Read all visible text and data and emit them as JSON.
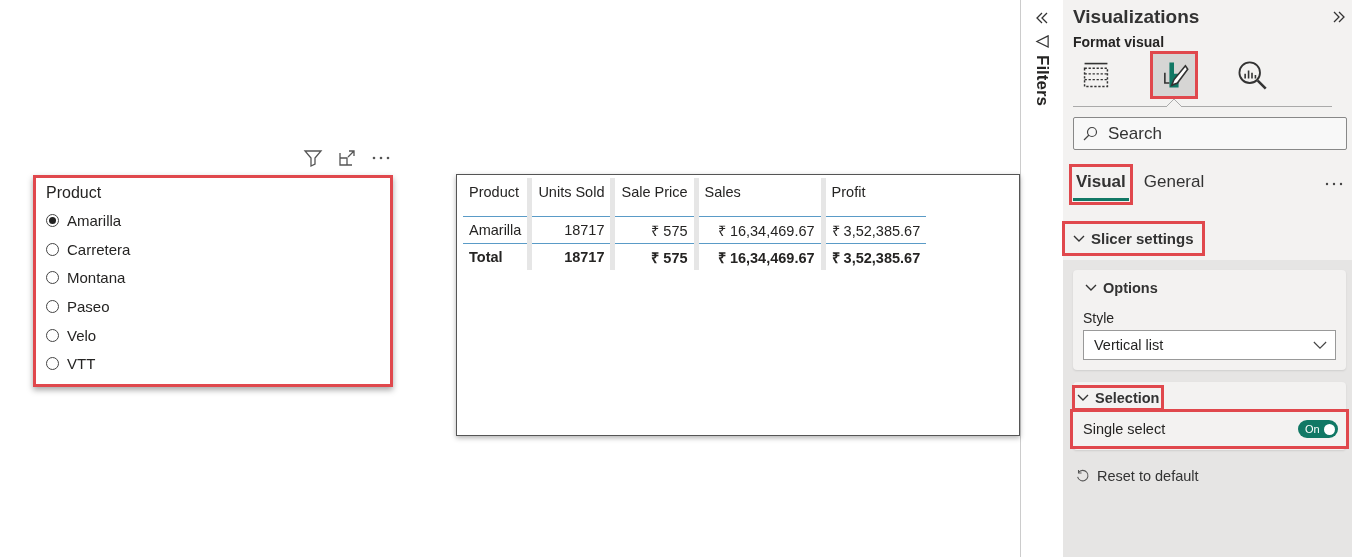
{
  "slicer": {
    "highlighted": true,
    "title": "Product",
    "items": [
      {
        "label": "Amarilla",
        "selected": true
      },
      {
        "label": "Carretera",
        "selected": false
      },
      {
        "label": "Montana",
        "selected": false
      },
      {
        "label": "Paseo",
        "selected": false
      },
      {
        "label": "Velo",
        "selected": false
      },
      {
        "label": "VTT",
        "selected": false
      }
    ]
  },
  "table": {
    "columns": [
      "Product",
      "Units Sold",
      "Sale Price",
      "Sales",
      "Profit"
    ],
    "rows": [
      [
        "Amarilla",
        "18717",
        "₹ 575",
        "₹ 16,34,469.67",
        "₹ 3,52,385.67"
      ]
    ],
    "total": [
      "Total",
      "18717",
      "₹ 575",
      "₹ 16,34,469.67",
      "₹ 3,52,385.67"
    ]
  },
  "filters_pane": {
    "label": "Filters"
  },
  "visualizations": {
    "title": "Visualizations",
    "subtitle": "Format visual",
    "panes": [
      {
        "kind": "build",
        "selected": false,
        "highlighted": false
      },
      {
        "kind": "format",
        "selected": true,
        "highlighted": true
      },
      {
        "kind": "analytics",
        "selected": false,
        "highlighted": false
      }
    ],
    "search": {
      "placeholder": "Search"
    },
    "tabs": [
      {
        "label": "Visual",
        "selected": true,
        "highlighted": true
      },
      {
        "label": "General",
        "selected": false,
        "highlighted": false
      }
    ],
    "section": {
      "title": "Slicer settings",
      "expanded": true,
      "highlighted": true
    },
    "options": {
      "title": "Options",
      "expanded": true,
      "style_label": "Style",
      "style_value": "Vertical list"
    },
    "selection": {
      "title": "Selection",
      "expanded": true,
      "highlighted": true,
      "toggle": {
        "label": "Single select",
        "on": true,
        "state_text": "On",
        "highlighted": true
      }
    },
    "reset": "Reset to default"
  }
}
